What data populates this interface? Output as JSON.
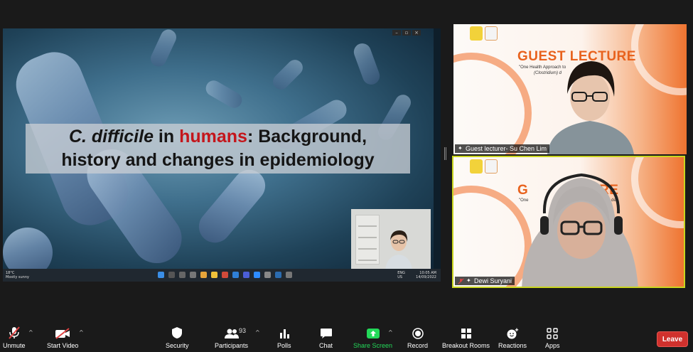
{
  "slide": {
    "title_part1": "C. difficile",
    "title_part2": " in ",
    "title_part3": "humans",
    "title_part4": ": Background,",
    "title_line2": "history and changes in epidemiology",
    "accent_color": "#c4161c"
  },
  "taskbar": {
    "weather_temp": "18°C",
    "weather_desc": "Mostly sunny",
    "lang_1": "ENG",
    "lang_2": "US",
    "time": "10:05 AM",
    "date": "14/09/2022"
  },
  "participants": [
    {
      "name": "Guest lecturer- Su Chen Lim",
      "bg_title": "GUEST LECTURE",
      "bg_sub1": "\"One Health Approach to",
      "bg_sub2": "(Clostridium) d"
    },
    {
      "name": "Dewi Suryani",
      "bg_title_a": "G",
      "bg_title_b": "RE",
      "bg_sub1": "\"One",
      "bg_sub2": "des"
    }
  ],
  "toolbar": {
    "unmute": "Unmute",
    "start_video": "Start Video",
    "security": "Security",
    "participants": "Participants",
    "participants_count": "93",
    "polls": "Polls",
    "chat": "Chat",
    "share_screen": "Share Screen",
    "record": "Record",
    "breakout_rooms": "Breakout Rooms",
    "reactions": "Reactions",
    "apps": "Apps",
    "leave": "Leave"
  },
  "colors": {
    "share_green": "#23d959",
    "leave_red": "#d0312d",
    "active_speaker": "#c9d51f",
    "muted_red": "#e04343"
  }
}
